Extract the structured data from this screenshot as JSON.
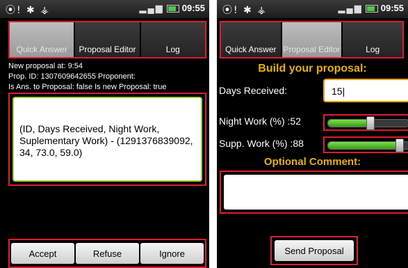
{
  "left_screen": {
    "status": {
      "icons": "⦿! ✱ ⚶",
      "time": "09:55"
    },
    "tabs": [
      "Quick Answer",
      "Proposal Editor",
      "Log"
    ],
    "active_tab": "Quick Answer",
    "info": {
      "line1": "New proposal at: 9:54",
      "line2": "Prop. ID: 1307609642655  Proponent:",
      "line3": "Is Ans. to Proposal: false   Is new Proposal: true"
    },
    "proposal_text": "(ID, Days Received, Night Work, Suplementary Work) - (1291376839092, 34, 73.0, 59.0)",
    "buttons": {
      "accept": "Accept",
      "refuse": "Refuse",
      "ignore": "Ignore"
    }
  },
  "right_screen": {
    "status": {
      "icons": "⦿! ✱ ⚶",
      "time": "09:55"
    },
    "tabs": [
      "Quick Answer",
      "Proposal Editor",
      "Log"
    ],
    "active_tab": "Proposal Editor",
    "build_title": "Build your proposal:",
    "days_label": "Days Received:",
    "days_value": "15",
    "night_label": "Night Work (%) :52",
    "night_value": 52,
    "supp_label": "Supp. Work (%) :88",
    "supp_value": 88,
    "optional_title": "Optional Comment:",
    "comment_value": "",
    "send_label": "Send Proposal"
  },
  "colors": {
    "highlight": "#e01b2e",
    "accent": "#e8b000",
    "slider": "#5ac02a"
  }
}
